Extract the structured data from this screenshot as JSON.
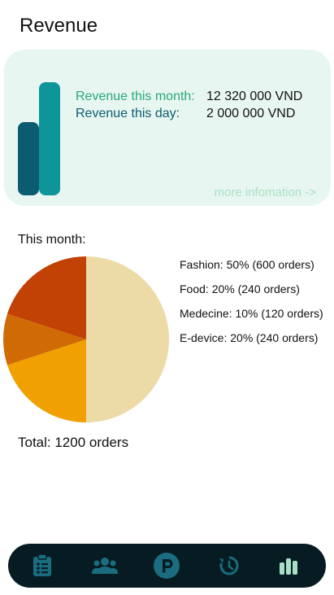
{
  "page": {
    "title": "Revenue"
  },
  "summary_card": {
    "month_label": "Revenue this month:",
    "month_value": "12 320 000 VND",
    "day_label": "Revenue this day:",
    "day_value": "2 000 000 VND",
    "more_link": "more infomation ->"
  },
  "breakdown": {
    "heading": "This month:",
    "total": "Total: 1200 orders",
    "legend": [
      "Fashion: 50% (600 orders)",
      "Food: 20% (240 orders)",
      "Medecine: 10% (120 orders)",
      "E-device: 20% (240 orders)"
    ]
  },
  "chart_data": {
    "type": "pie",
    "categories": [
      "Fashion",
      "Food",
      "Medecine",
      "E-device"
    ],
    "values": [
      50,
      20,
      10,
      20
    ],
    "colors": [
      "#ecdaa7",
      "#f0a000",
      "#d06a05",
      "#c24206"
    ]
  },
  "colors": {
    "accent_green": "#2aa877",
    "accent_teal": "#0b5c70",
    "card_bg": "#e8f6f1",
    "nav_bg": "#071c22",
    "nav_icon": "#1a6d80",
    "nav_icon_active": "#a8e0c5"
  },
  "bottom_nav": {
    "items": [
      {
        "icon": "clipboard-list-icon",
        "active": false
      },
      {
        "icon": "users-icon",
        "active": false
      },
      {
        "icon": "parking-icon",
        "active": false
      },
      {
        "icon": "history-icon",
        "active": false
      },
      {
        "icon": "bar-chart-icon",
        "active": true
      }
    ]
  }
}
